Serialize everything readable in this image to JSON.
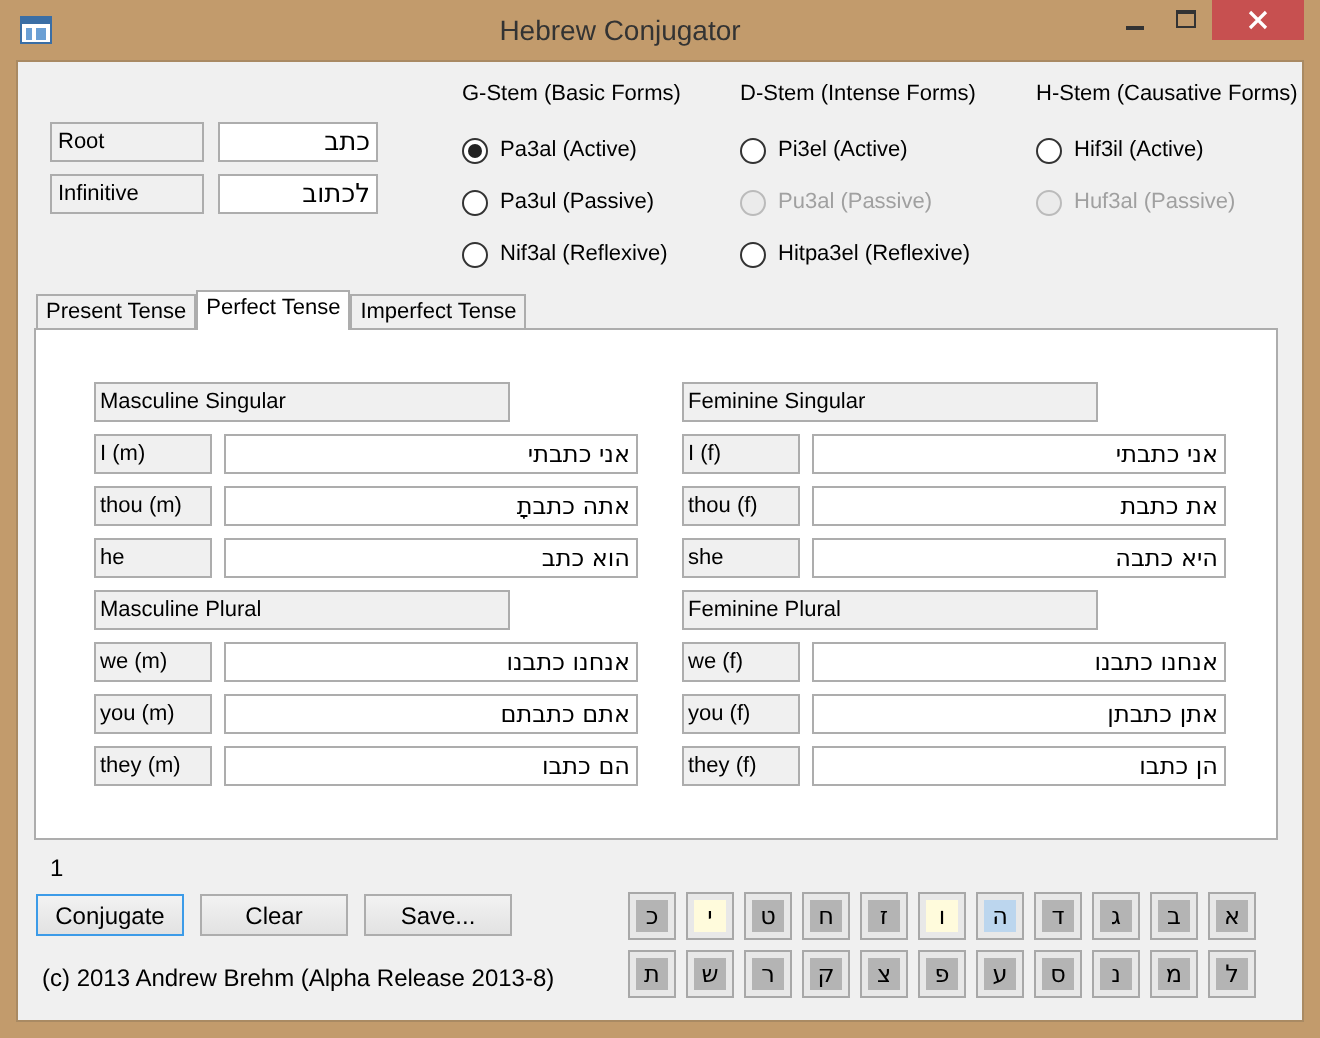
{
  "window": {
    "title": "Hebrew Conjugator"
  },
  "fields": [
    {
      "label": "Root",
      "value": "כתב"
    },
    {
      "label": "Infinitive",
      "value": "לכתוב"
    }
  ],
  "stems": [
    {
      "heading": "G-Stem (Basic Forms)",
      "options": [
        {
          "label": "Pa3al (Active)",
          "selected": true,
          "disabled": false
        },
        {
          "label": "Pa3ul (Passive)",
          "selected": false,
          "disabled": false
        },
        {
          "label": "Nif3al (Reflexive)",
          "selected": false,
          "disabled": false
        }
      ]
    },
    {
      "heading": "D-Stem (Intense Forms)",
      "options": [
        {
          "label": "Pi3el (Active)",
          "selected": false,
          "disabled": false
        },
        {
          "label": "Pu3al (Passive)",
          "selected": false,
          "disabled": true
        },
        {
          "label": "Hitpa3el (Reflexive)",
          "selected": false,
          "disabled": false
        }
      ]
    },
    {
      "heading": "H-Stem (Causative Forms)",
      "options": [
        {
          "label": "Hif3il (Active)",
          "selected": false,
          "disabled": false
        },
        {
          "label": "Huf3al (Passive)",
          "selected": false,
          "disabled": true
        }
      ]
    }
  ],
  "tabs": [
    {
      "label": "Present Tense",
      "selected": false
    },
    {
      "label": "Perfect Tense",
      "selected": true
    },
    {
      "label": "Imperfect Tense",
      "selected": false
    }
  ],
  "columns": [
    {
      "groups": [
        {
          "heading": "Masculine Singular",
          "rows": [
            {
              "label": "I (m)",
              "value": "אני כתבתי"
            },
            {
              "label": "thou (m)",
              "value": "אתה כתבתָ"
            },
            {
              "label": "he",
              "value": "הוא כתב"
            }
          ]
        },
        {
          "heading": "Masculine Plural",
          "rows": [
            {
              "label": "we (m)",
              "value": "אנחנו כתבנו"
            },
            {
              "label": "you (m)",
              "value": "אתם כתבתם"
            },
            {
              "label": "they (m)",
              "value": "הם כתבו"
            }
          ]
        }
      ]
    },
    {
      "groups": [
        {
          "heading": "Feminine Singular",
          "rows": [
            {
              "label": "I (f)",
              "value": "אני כתבתי"
            },
            {
              "label": "thou (f)",
              "value": "את כתבת"
            },
            {
              "label": "she",
              "value": "היא כתבה"
            }
          ]
        },
        {
          "heading": "Feminine Plural",
          "rows": [
            {
              "label": "we (f)",
              "value": "אנחנו כתבנו"
            },
            {
              "label": "you (f)",
              "value": "אתן כתבתן"
            },
            {
              "label": "they (f)",
              "value": "הן כתבו"
            }
          ]
        }
      ]
    }
  ],
  "counter": "1",
  "buttons": [
    {
      "label": "Conjugate",
      "focused": true
    },
    {
      "label": "Clear",
      "focused": false
    },
    {
      "label": "Save...",
      "focused": false
    }
  ],
  "copyright": "(c) 2013 Andrew Brehm (Alpha Release 2013-8)",
  "keyboard": [
    [
      {
        "letter": "א",
        "color": "#b4b4b4"
      },
      {
        "letter": "ב",
        "color": "#b4b4b4"
      },
      {
        "letter": "ג",
        "color": "#b4b4b4"
      },
      {
        "letter": "ד",
        "color": "#b4b4b4"
      },
      {
        "letter": "ה",
        "color": "#bcd6ee"
      },
      {
        "letter": "ו",
        "color": "#fffbdc"
      },
      {
        "letter": "ז",
        "color": "#b4b4b4"
      },
      {
        "letter": "ח",
        "color": "#b4b4b4"
      },
      {
        "letter": "ט",
        "color": "#b4b4b4"
      },
      {
        "letter": "י",
        "color": "#fffbdc"
      },
      {
        "letter": "כ",
        "color": "#b4b4b4"
      }
    ],
    [
      {
        "letter": "ל",
        "color": "#b4b4b4"
      },
      {
        "letter": "מ",
        "color": "#b4b4b4"
      },
      {
        "letter": "נ",
        "color": "#b4b4b4"
      },
      {
        "letter": "ס",
        "color": "#b4b4b4"
      },
      {
        "letter": "ע",
        "color": "#b4b4b4"
      },
      {
        "letter": "פ",
        "color": "#b4b4b4"
      },
      {
        "letter": "צ",
        "color": "#b4b4b4"
      },
      {
        "letter": "ק",
        "color": "#b4b4b4"
      },
      {
        "letter": "ר",
        "color": "#b4b4b4"
      },
      {
        "letter": "ש",
        "color": "#b4b4b4"
      },
      {
        "letter": "ת",
        "color": "#b4b4b4"
      }
    ]
  ]
}
